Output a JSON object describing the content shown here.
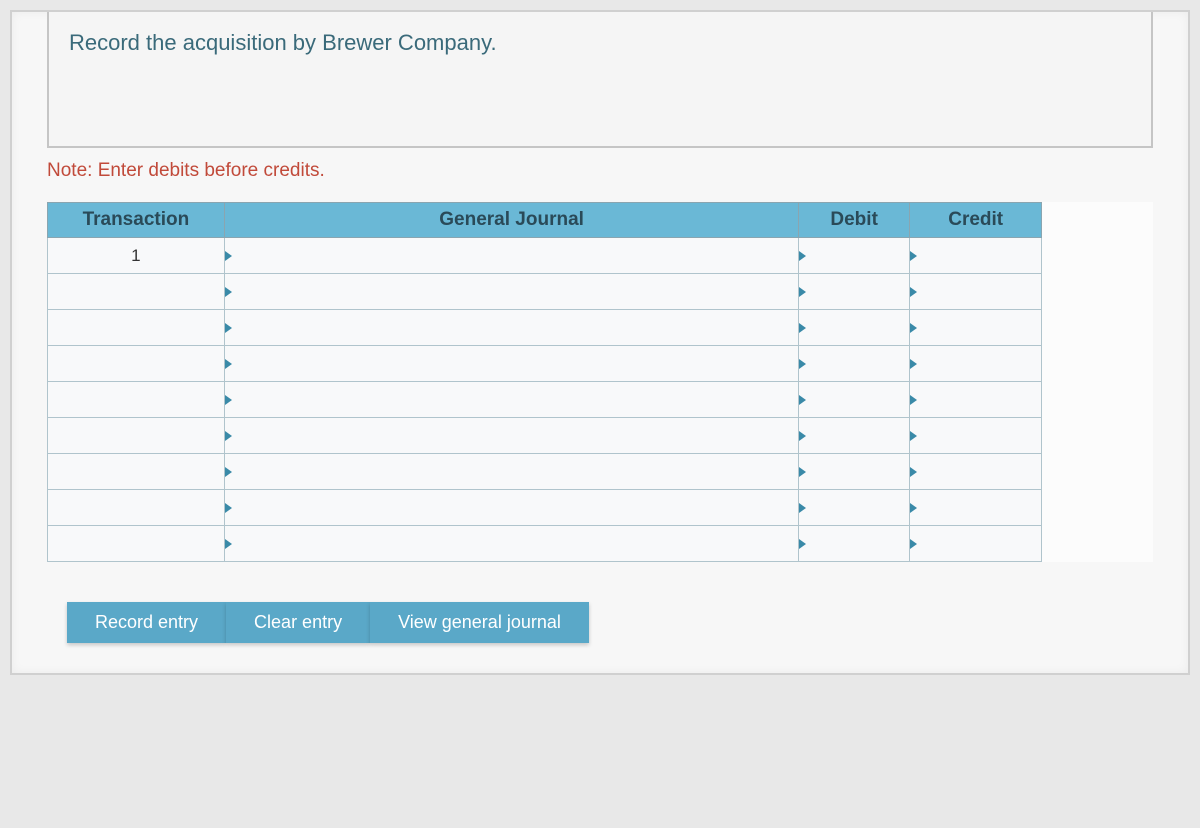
{
  "instruction": "Record the acquisition by Brewer Company.",
  "note": "Note: Enter debits before credits.",
  "headers": {
    "transaction": "Transaction",
    "general_journal": "General Journal",
    "debit": "Debit",
    "credit": "Credit"
  },
  "rows": [
    {
      "transaction": "1",
      "journal": "",
      "debit": "",
      "credit": ""
    },
    {
      "transaction": "",
      "journal": "",
      "debit": "",
      "credit": ""
    },
    {
      "transaction": "",
      "journal": "",
      "debit": "",
      "credit": ""
    },
    {
      "transaction": "",
      "journal": "",
      "debit": "",
      "credit": ""
    },
    {
      "transaction": "",
      "journal": "",
      "debit": "",
      "credit": ""
    },
    {
      "transaction": "",
      "journal": "",
      "debit": "",
      "credit": ""
    },
    {
      "transaction": "",
      "journal": "",
      "debit": "",
      "credit": ""
    },
    {
      "transaction": "",
      "journal": "",
      "debit": "",
      "credit": ""
    },
    {
      "transaction": "",
      "journal": "",
      "debit": "",
      "credit": ""
    }
  ],
  "buttons": {
    "record": "Record entry",
    "clear": "Clear entry",
    "view": "View general journal"
  }
}
